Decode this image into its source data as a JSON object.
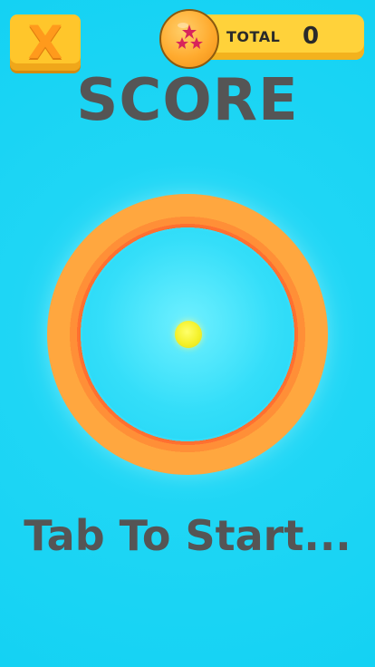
{
  "top_bar": {
    "close_label": "X",
    "total_label": "TOTAL",
    "total_value": "0",
    "coin_icon": "dragon-ball-icon"
  },
  "title": "SCORE",
  "prompt": "Tab To Start...",
  "colors": {
    "background": "#14d2f3",
    "button_yellow": "#ffc62b",
    "ring_orange": "#ffa73f",
    "ring_inner_orange": "#ff7030",
    "ball_yellow": "#f4f12a",
    "text_gray": "#555555"
  }
}
